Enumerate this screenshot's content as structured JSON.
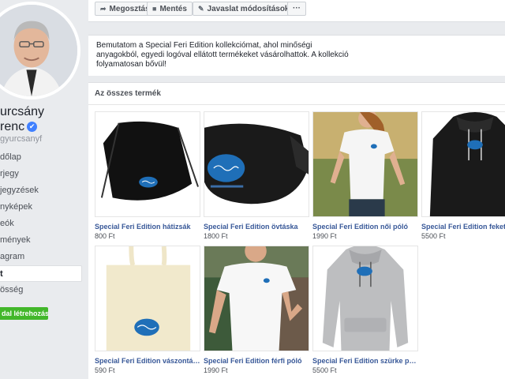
{
  "profile": {
    "name_line1": "urcsány",
    "name_line2": "renc",
    "verified_glyph": "✔",
    "handle": "gyurcsanyf"
  },
  "sidebar": {
    "items": [
      {
        "label": "dőlap"
      },
      {
        "label": "rjegy"
      },
      {
        "label": "jegyzések"
      },
      {
        "label": "nyképek"
      },
      {
        "label": "eók"
      },
      {
        "label": "mények"
      },
      {
        "label": "agram"
      },
      {
        "label": "t",
        "active": true
      },
      {
        "label": "össég"
      }
    ],
    "create_button": "dal létrehozása"
  },
  "toolbar": {
    "share": {
      "label": "Megosztás",
      "icon": "share-icon"
    },
    "save": {
      "label": "Mentés",
      "icon": "bookmark-icon"
    },
    "suggest": {
      "label": "Javaslat módosításokra",
      "icon": "pencil-icon"
    },
    "more": {
      "label": "···",
      "icon": "more-icon"
    }
  },
  "about": {
    "text": "Bemutatom a Special Feri Edition kollekciómat, ahol minőségi anyagokból, egyedi logóval ellátott termékeket vásárolhattok. A kollekció folyamatosan bővül!"
  },
  "products": {
    "section_title": "Az összes termék",
    "items": [
      {
        "title": "Special Feri Edition hátizsák",
        "price": "800 Ft",
        "image": "black-drawstring-bag"
      },
      {
        "title": "Special Feri Edition övtáska",
        "price": "1800 Ft",
        "image": "black-fanny-pack"
      },
      {
        "title": "Special Feri Edition női póló",
        "price": "1990 Ft",
        "image": "woman-white-tshirt"
      },
      {
        "title": "Special Feri Edition fekete p",
        "price": "5500 Ft",
        "image": "black-hoodie"
      },
      {
        "title": "Special Feri Edition vászontáska",
        "price": "590 Ft",
        "image": "canvas-tote-bag"
      },
      {
        "title": "Special Feri Edition férfi póló",
        "price": "1990 Ft",
        "image": "man-white-tshirt"
      },
      {
        "title": "Special Feri Edition szürke pul...",
        "price": "5500 Ft",
        "image": "grey-hoodie"
      }
    ]
  },
  "colors": {
    "link": "#385898",
    "logo_blue": "#1f6fb8",
    "create_green": "#42b72a",
    "verified_blue": "#4080ff"
  }
}
